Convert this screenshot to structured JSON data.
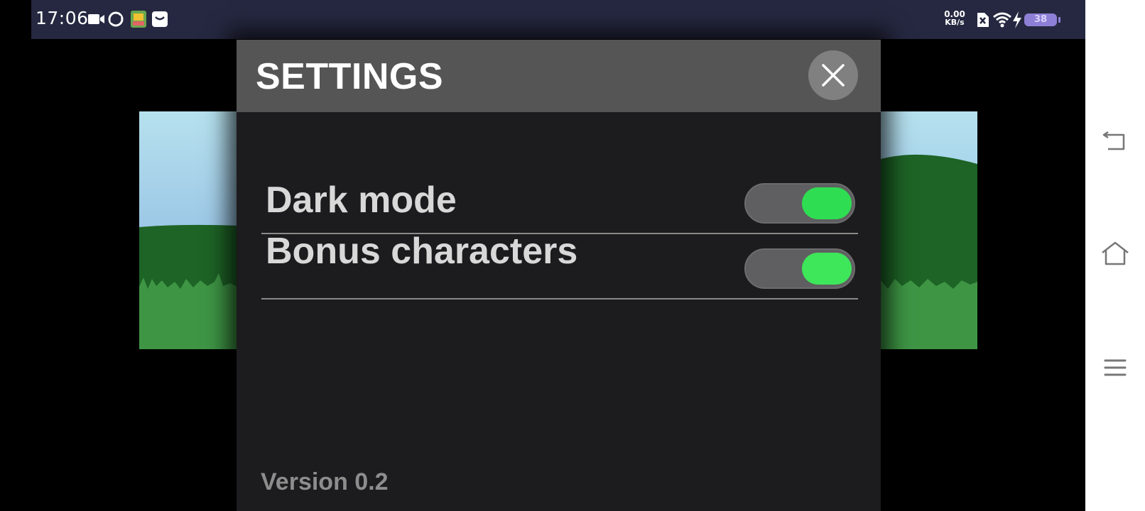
{
  "status_bar": {
    "time": "17:06",
    "left_icons": [
      "video-camera-icon",
      "sync-icon",
      "app-thumbnail-icon",
      "mail-icon"
    ],
    "net_speed_value": "0.00",
    "net_speed_unit": "KB/s",
    "right_icons": [
      "sim-x-icon",
      "wifi-icon",
      "charging-bolt-icon"
    ],
    "battery_level": "38",
    "battery_color": "#8e7fd6"
  },
  "settings": {
    "title": "SETTINGS",
    "close_icon": "close-icon",
    "options": [
      {
        "label": "Dark mode",
        "enabled": true,
        "knob_color": "#2fdd52"
      },
      {
        "label": "Bonus characters",
        "enabled": true,
        "knob_color": "#3ee65a"
      }
    ],
    "version": "Version 0.2"
  },
  "nav_bar": {
    "icons": [
      "back-icon",
      "home-icon",
      "menu-icon"
    ]
  }
}
